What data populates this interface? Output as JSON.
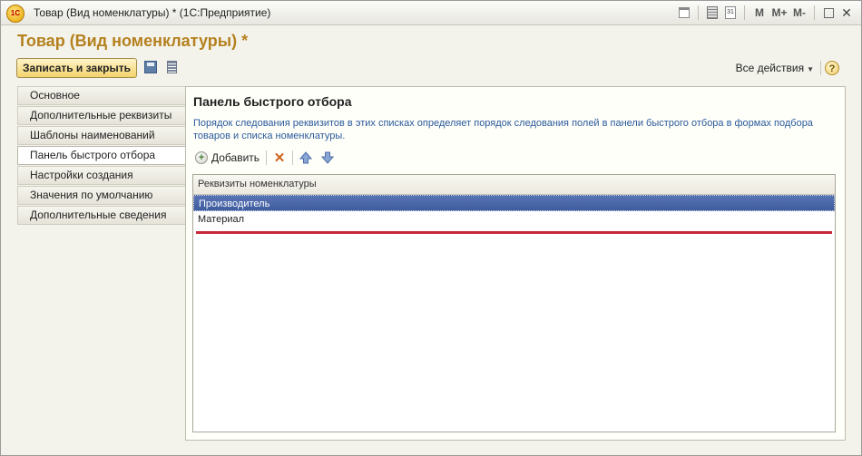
{
  "window": {
    "title": "Товар (Вид номенклатуры) *  (1С:Предприятие)",
    "logo_text": "1С",
    "controls": [
      "M",
      "M+",
      "M-"
    ]
  },
  "form": {
    "heading": "Товар (Вид номенклатуры) *",
    "save_close_label": "Записать и закрыть",
    "all_actions_label": "Все действия",
    "help_label": "?"
  },
  "tabs": [
    {
      "label": "Основное",
      "active": false
    },
    {
      "label": "Дополнительные реквизиты",
      "active": false
    },
    {
      "label": "Шаблоны наименований",
      "active": false
    },
    {
      "label": "Панель быстрого отбора",
      "active": true
    },
    {
      "label": "Настройки создания",
      "active": false
    },
    {
      "label": "Значения по умолчанию",
      "active": false
    },
    {
      "label": "Дополнительные сведения",
      "active": false
    }
  ],
  "panel": {
    "title": "Панель быстрого отбора",
    "description": "Порядок следования реквизитов в этих списках определяет порядок следования полей в панели быстрого отбора в формах подбора товаров и списка номенклатуры.",
    "add_label": "Добавить",
    "table": {
      "header": "Реквизиты номенклатуры",
      "rows": [
        "Производитель",
        "Материал"
      ]
    }
  },
  "colors": {
    "heading": "#b5811f",
    "selection": "#3f5c9e",
    "red_line": "#c8283a"
  }
}
